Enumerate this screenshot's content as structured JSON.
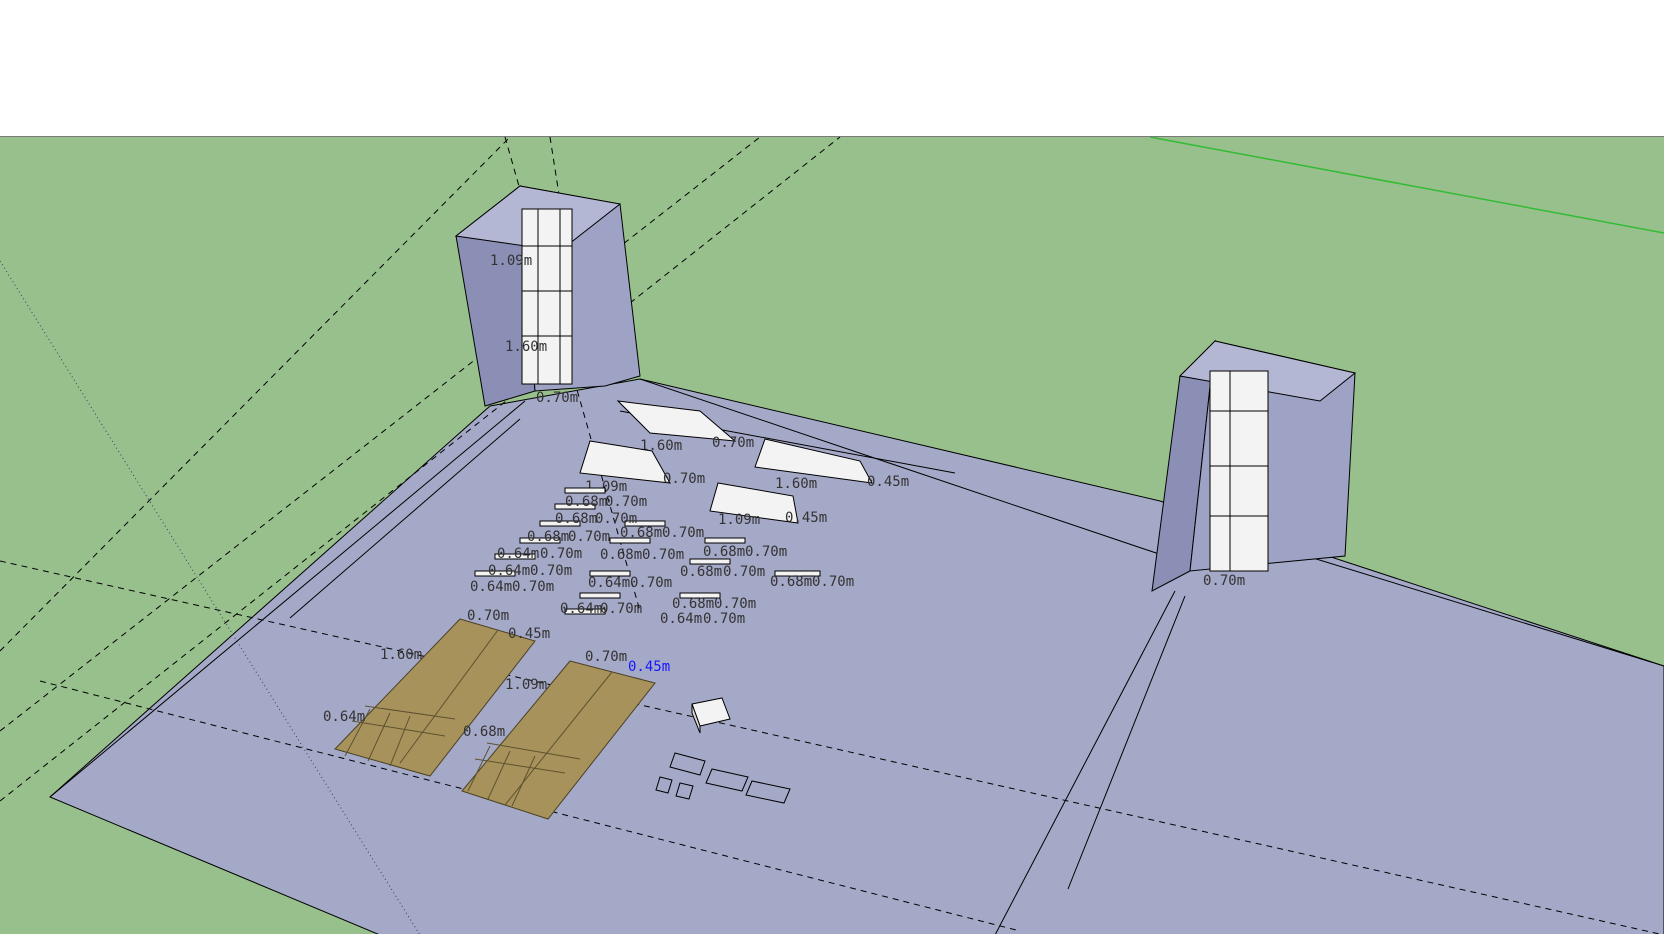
{
  "colors": {
    "ground": "#98c08c",
    "floor": "#a5a9c8",
    "wall": "#9ea2c5",
    "wall_side": "#8b8fb5",
    "panel": "#f3f3f3",
    "wood": "#a6925a",
    "green_axis": "#33bb33",
    "selected_dim": "#1515ff"
  },
  "icons": {
    "small_box": "box-component-icon"
  },
  "dimensions": {
    "tower_left": [
      "1.09m",
      "1.60m",
      "0.70m"
    ],
    "tower_right": [
      "0.70m"
    ],
    "board_a": [
      "1.60m",
      "0.70m"
    ],
    "board_b": [
      "1.09m",
      "0.70m"
    ],
    "board_c": [
      "1.60m",
      "0.45m"
    ],
    "board_d": [
      "1.09m",
      "0.45m"
    ],
    "strip_labels": [
      "0.68m",
      "0.70m",
      "0.68m",
      "0.70m",
      "0.68m",
      "0.70m",
      "0.68m",
      "0.70m",
      "0.68m",
      "0.70m",
      "0.64m",
      "0.70m",
      "0.64m",
      "0.70m",
      "0.64m",
      "0.70m",
      "0.64m",
      "0.70m",
      "0.68m",
      "0.70m",
      "0.68m",
      "0.70m",
      "0.68m",
      "0.70m",
      "0.68m",
      "0.70m",
      "0.64m",
      "0.70m",
      "0.64m",
      "0.70m"
    ],
    "wood_left": [
      "0.70m",
      "0.45m",
      "1.60m",
      "0.64m"
    ],
    "wood_right": [
      "0.70m",
      "1.09m",
      "0.68m"
    ],
    "selected": "0.45m"
  }
}
